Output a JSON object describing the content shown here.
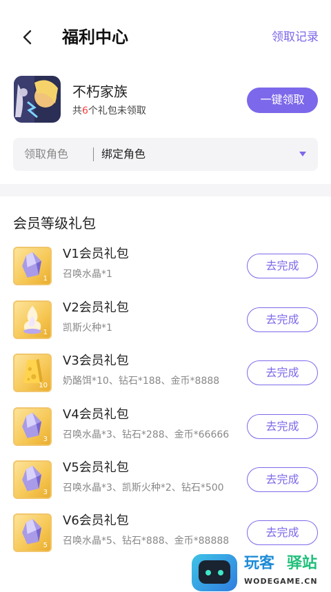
{
  "header": {
    "title": "福利中心",
    "record_label": "领取记录"
  },
  "game": {
    "name": "不朽家族",
    "sub_prefix": "共",
    "sub_count": "6",
    "sub_suffix": "个礼包未领取",
    "claim_all_label": "一键领取"
  },
  "role": {
    "label": "领取角色",
    "value": "绑定角色"
  },
  "section": {
    "title": "会员等级礼包"
  },
  "packages": [
    {
      "name": "V1会员礼包",
      "items": "召唤水晶*1",
      "badge": "1",
      "icon": "crystal-icon",
      "button": "去完成"
    },
    {
      "name": "V2会员礼包",
      "items": "凯斯火种*1",
      "badge": "1",
      "icon": "flame-icon",
      "button": "去完成"
    },
    {
      "name": "V3会员礼包",
      "items": "奶酪饵*10、钻石*188、金币*8888",
      "badge": "10",
      "icon": "cheese-icon",
      "button": "去完成"
    },
    {
      "name": "V4会员礼包",
      "items": "召唤水晶*3、钻石*288、金币*66666",
      "badge": "3",
      "icon": "crystal-icon",
      "button": "去完成"
    },
    {
      "name": "V5会员礼包",
      "items": "召唤水晶*3、凯斯火种*2、钻石*500",
      "badge": "3",
      "icon": "crystal-icon",
      "button": "去完成"
    },
    {
      "name": "V6会员礼包",
      "items": "召唤水晶*5、钻石*888、金币*88888",
      "badge": "5",
      "icon": "crystal-icon",
      "button": "去完成"
    }
  ],
  "watermark": {
    "title_part1": "玩客",
    "title_part2": "驿站",
    "url": "WODEGAME.CN"
  },
  "colors": {
    "accent": "#7c68ea",
    "highlight": "#ff3b3b",
    "thumb_gold": "#f6c754"
  }
}
